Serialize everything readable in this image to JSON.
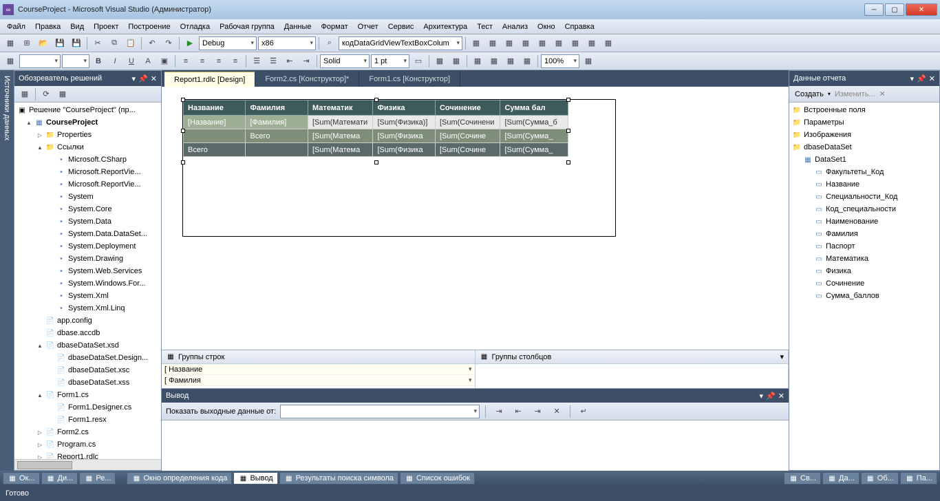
{
  "title": "CourseProject - Microsoft Visual Studio (Администратор)",
  "menu": [
    "Файл",
    "Правка",
    "Вид",
    "Проект",
    "Построение",
    "Отладка",
    "Рабочая группа",
    "Данные",
    "Формат",
    "Отчет",
    "Сервис",
    "Архитектура",
    "Тест",
    "Анализ",
    "Окно",
    "Справка"
  ],
  "toolbar1": {
    "config": "Debug",
    "platform": "x86",
    "search": "кодDataGridViewTextBoxColum"
  },
  "toolbar2": {
    "linestyle": "Solid",
    "lineweight": "1 pt",
    "zoom": "100%"
  },
  "sidetab": "Источники данных",
  "solution_panel": {
    "title": "Обозреватель решений",
    "root": "Решение \"CourseProject\"  (пр...",
    "project": "CourseProject",
    "nodes": [
      {
        "d": 1,
        "exp": "▷",
        "icon": "📁",
        "label": "Properties"
      },
      {
        "d": 1,
        "exp": "▲",
        "icon": "📁",
        "label": "Ссылки"
      },
      {
        "d": 2,
        "exp": "",
        "icon": "•",
        "label": "Microsoft.CSharp"
      },
      {
        "d": 2,
        "exp": "",
        "icon": "•",
        "label": "Microsoft.ReportViе..."
      },
      {
        "d": 2,
        "exp": "",
        "icon": "•",
        "label": "Microsoft.ReportViе..."
      },
      {
        "d": 2,
        "exp": "",
        "icon": "•",
        "label": "System"
      },
      {
        "d": 2,
        "exp": "",
        "icon": "•",
        "label": "System.Core"
      },
      {
        "d": 2,
        "exp": "",
        "icon": "•",
        "label": "System.Data"
      },
      {
        "d": 2,
        "exp": "",
        "icon": "•",
        "label": "System.Data.DataSet..."
      },
      {
        "d": 2,
        "exp": "",
        "icon": "•",
        "label": "System.Deployment"
      },
      {
        "d": 2,
        "exp": "",
        "icon": "•",
        "label": "System.Drawing"
      },
      {
        "d": 2,
        "exp": "",
        "icon": "•",
        "label": "System.Web.Services"
      },
      {
        "d": 2,
        "exp": "",
        "icon": "•",
        "label": "System.Windows.For..."
      },
      {
        "d": 2,
        "exp": "",
        "icon": "•",
        "label": "System.Xml"
      },
      {
        "d": 2,
        "exp": "",
        "icon": "•",
        "label": "System.Xml.Linq"
      },
      {
        "d": 1,
        "exp": "",
        "icon": "📄",
        "label": "app.config"
      },
      {
        "d": 1,
        "exp": "",
        "icon": "📄",
        "label": "dbase.accdb"
      },
      {
        "d": 1,
        "exp": "▲",
        "icon": "📄",
        "label": "dbaseDataSet.xsd"
      },
      {
        "d": 2,
        "exp": "",
        "icon": "📄",
        "label": "dbaseDataSet.Design..."
      },
      {
        "d": 2,
        "exp": "",
        "icon": "📄",
        "label": "dbaseDataSet.xsc"
      },
      {
        "d": 2,
        "exp": "",
        "icon": "📄",
        "label": "dbaseDataSet.xss"
      },
      {
        "d": 1,
        "exp": "▲",
        "icon": "📄",
        "label": "Form1.cs"
      },
      {
        "d": 2,
        "exp": "",
        "icon": "📄",
        "label": "Form1.Designer.cs"
      },
      {
        "d": 2,
        "exp": "",
        "icon": "📄",
        "label": "Form1.resx"
      },
      {
        "d": 1,
        "exp": "▷",
        "icon": "📄",
        "label": "Form2.cs"
      },
      {
        "d": 1,
        "exp": "▷",
        "icon": "📄",
        "label": "Program.cs"
      },
      {
        "d": 1,
        "exp": "▷",
        "icon": "📄",
        "label": "Report1.rdlc"
      }
    ]
  },
  "tabs": [
    {
      "label": "Report1.rdlc [Design]",
      "active": true
    },
    {
      "label": "Form2.cs [Конструктор]*",
      "active": false
    },
    {
      "label": "Form1.cs [Конструктор]",
      "active": false
    }
  ],
  "report": {
    "headers": [
      "Название",
      "Фамилия",
      "Математик",
      "Физика",
      "Сочинение",
      "Сумма бал"
    ],
    "row1": [
      "[Название]",
      "[Фамилия]",
      "[Sum(Математи",
      "[Sum(Физика)]",
      "[Sum(Сочинени",
      "[Sum(Сумма_б"
    ],
    "row2": [
      "",
      "Всего",
      "[Sum(Матема",
      "[Sum(Физика",
      "[Sum(Сочине",
      "[Sum(Сумма_"
    ],
    "row3": [
      "Всего",
      "",
      "[Sum(Матема",
      "[Sum(Физика",
      "[Sum(Сочине",
      "[Sum(Сумма_"
    ]
  },
  "row_groups_title": "Группы строк",
  "col_groups_title": "Группы столбцов",
  "row_groups": [
    "Название",
    "Фамилия"
  ],
  "output": {
    "title": "Вывод",
    "filter_label": "Показать выходные данные от:"
  },
  "report_data": {
    "title": "Данные отчета",
    "create": "Создать",
    "edit": "Изменить...",
    "nodes": [
      {
        "d": 0,
        "icon": "📁",
        "label": "Встроенные поля"
      },
      {
        "d": 0,
        "icon": "📁",
        "label": "Параметры"
      },
      {
        "d": 0,
        "icon": "📁",
        "label": "Изображения"
      },
      {
        "d": 0,
        "icon": "📁",
        "label": "dbaseDataSet"
      },
      {
        "d": 1,
        "icon": "▦",
        "label": "DataSet1"
      },
      {
        "d": 2,
        "icon": "▭",
        "label": "Факультеты_Код"
      },
      {
        "d": 2,
        "icon": "▭",
        "label": "Название"
      },
      {
        "d": 2,
        "icon": "▭",
        "label": "Специальности_Код"
      },
      {
        "d": 2,
        "icon": "▭",
        "label": "Код_специальности"
      },
      {
        "d": 2,
        "icon": "▭",
        "label": "Наименование"
      },
      {
        "d": 2,
        "icon": "▭",
        "label": "Фамилия"
      },
      {
        "d": 2,
        "icon": "▭",
        "label": "Паспорт"
      },
      {
        "d": 2,
        "icon": "▭",
        "label": "Математика"
      },
      {
        "d": 2,
        "icon": "▭",
        "label": "Физика"
      },
      {
        "d": 2,
        "icon": "▭",
        "label": "Сочинение"
      },
      {
        "d": 2,
        "icon": "▭",
        "label": "Сумма_баллов"
      }
    ]
  },
  "bottom_tabs_left": [
    "Ок...",
    "Ди...",
    "Ре..."
  ],
  "bottom_tabs_center": [
    "Окно определения кода",
    "Вывод",
    "Результаты поиска символа",
    "Список ошибок"
  ],
  "bottom_tabs_right": [
    "Св...",
    "Да...",
    "Об...",
    "Па..."
  ],
  "status": "Готово"
}
